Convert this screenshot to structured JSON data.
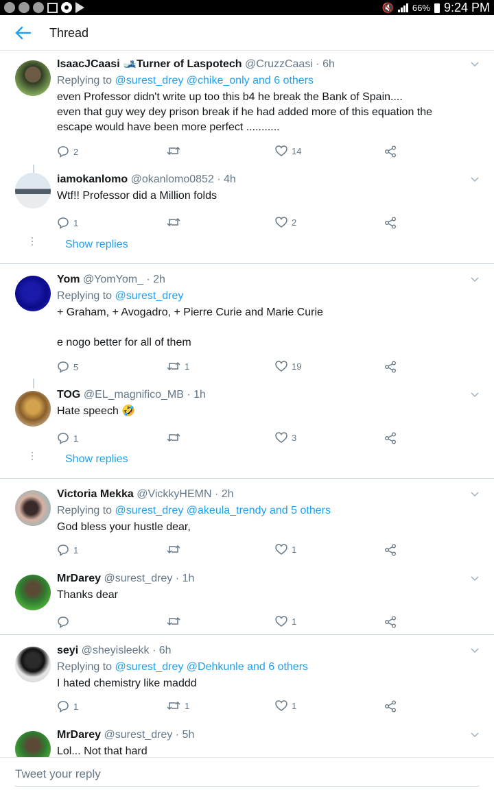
{
  "status_bar": {
    "battery": "66%",
    "time": "9:24 PM"
  },
  "header": {
    "title": "Thread"
  },
  "tweets": [
    {
      "name": "IsaacJCaasi 🎿Turner of Laspotech",
      "handle": "@CruzzCaasi · 6h",
      "replying_prefix": "Replying to ",
      "replying_to": "@surest_drey @chike_only and 6 others",
      "text": "even Professor didn't write up too this b4 he break the Bank of Spain....\neven that guy wey dey prison break if he had added more of this equation the escape would have been more perfect ...........",
      "replies": "2",
      "retweets": "",
      "likes": "14"
    },
    {
      "name": "iamokanlomo",
      "handle": "@okanlomo0852 · 4h",
      "text": "Wtf!! Professor did a Million folds",
      "replies": "1",
      "retweets": "",
      "likes": "2"
    },
    {
      "name": "Yom",
      "handle": "@YomYom_ · 2h",
      "replying_prefix": "Replying to ",
      "replying_to": "@surest_drey",
      "text": "+ Graham, + Avogadro, + Pierre Curie and Marie Curie\n\ne nogo better for all of them",
      "replies": "5",
      "retweets": "1",
      "likes": "19"
    },
    {
      "name": "TOG",
      "handle": "@EL_magnifico_MB · 1h",
      "text": "Hate speech 🤣",
      "replies": "1",
      "retweets": "",
      "likes": "3"
    },
    {
      "name": "Victoria Mekka",
      "handle": "@VickkyHEMN · 2h",
      "replying_prefix": "Replying to ",
      "replying_to": "@surest_drey @akeula_trendy and 5 others",
      "text": "God bless your hustle dear,",
      "replies": "1",
      "retweets": "",
      "likes": "1"
    },
    {
      "name": "MrDarey",
      "handle": "@surest_drey · 1h",
      "text": "Thanks dear",
      "replies": "",
      "retweets": "",
      "likes": "1"
    },
    {
      "name": "seyi",
      "handle": "@sheyisleekk · 6h",
      "replying_prefix": "Replying to ",
      "replying_to": "@surest_drey @Dehkunle and 6 others",
      "text": "I hated chemistry like maddd",
      "replies": "1",
      "retweets": "1",
      "likes": "1"
    },
    {
      "name": "MrDarey",
      "handle": "@surest_drey · 5h",
      "text": "Lol... Not that hard"
    }
  ],
  "show_replies_label": "Show replies",
  "composer": {
    "placeholder": "Tweet your reply"
  },
  "colors": {
    "accent": "#1da1f2",
    "muted": "#657786",
    "divider": "#ccd6dd"
  }
}
